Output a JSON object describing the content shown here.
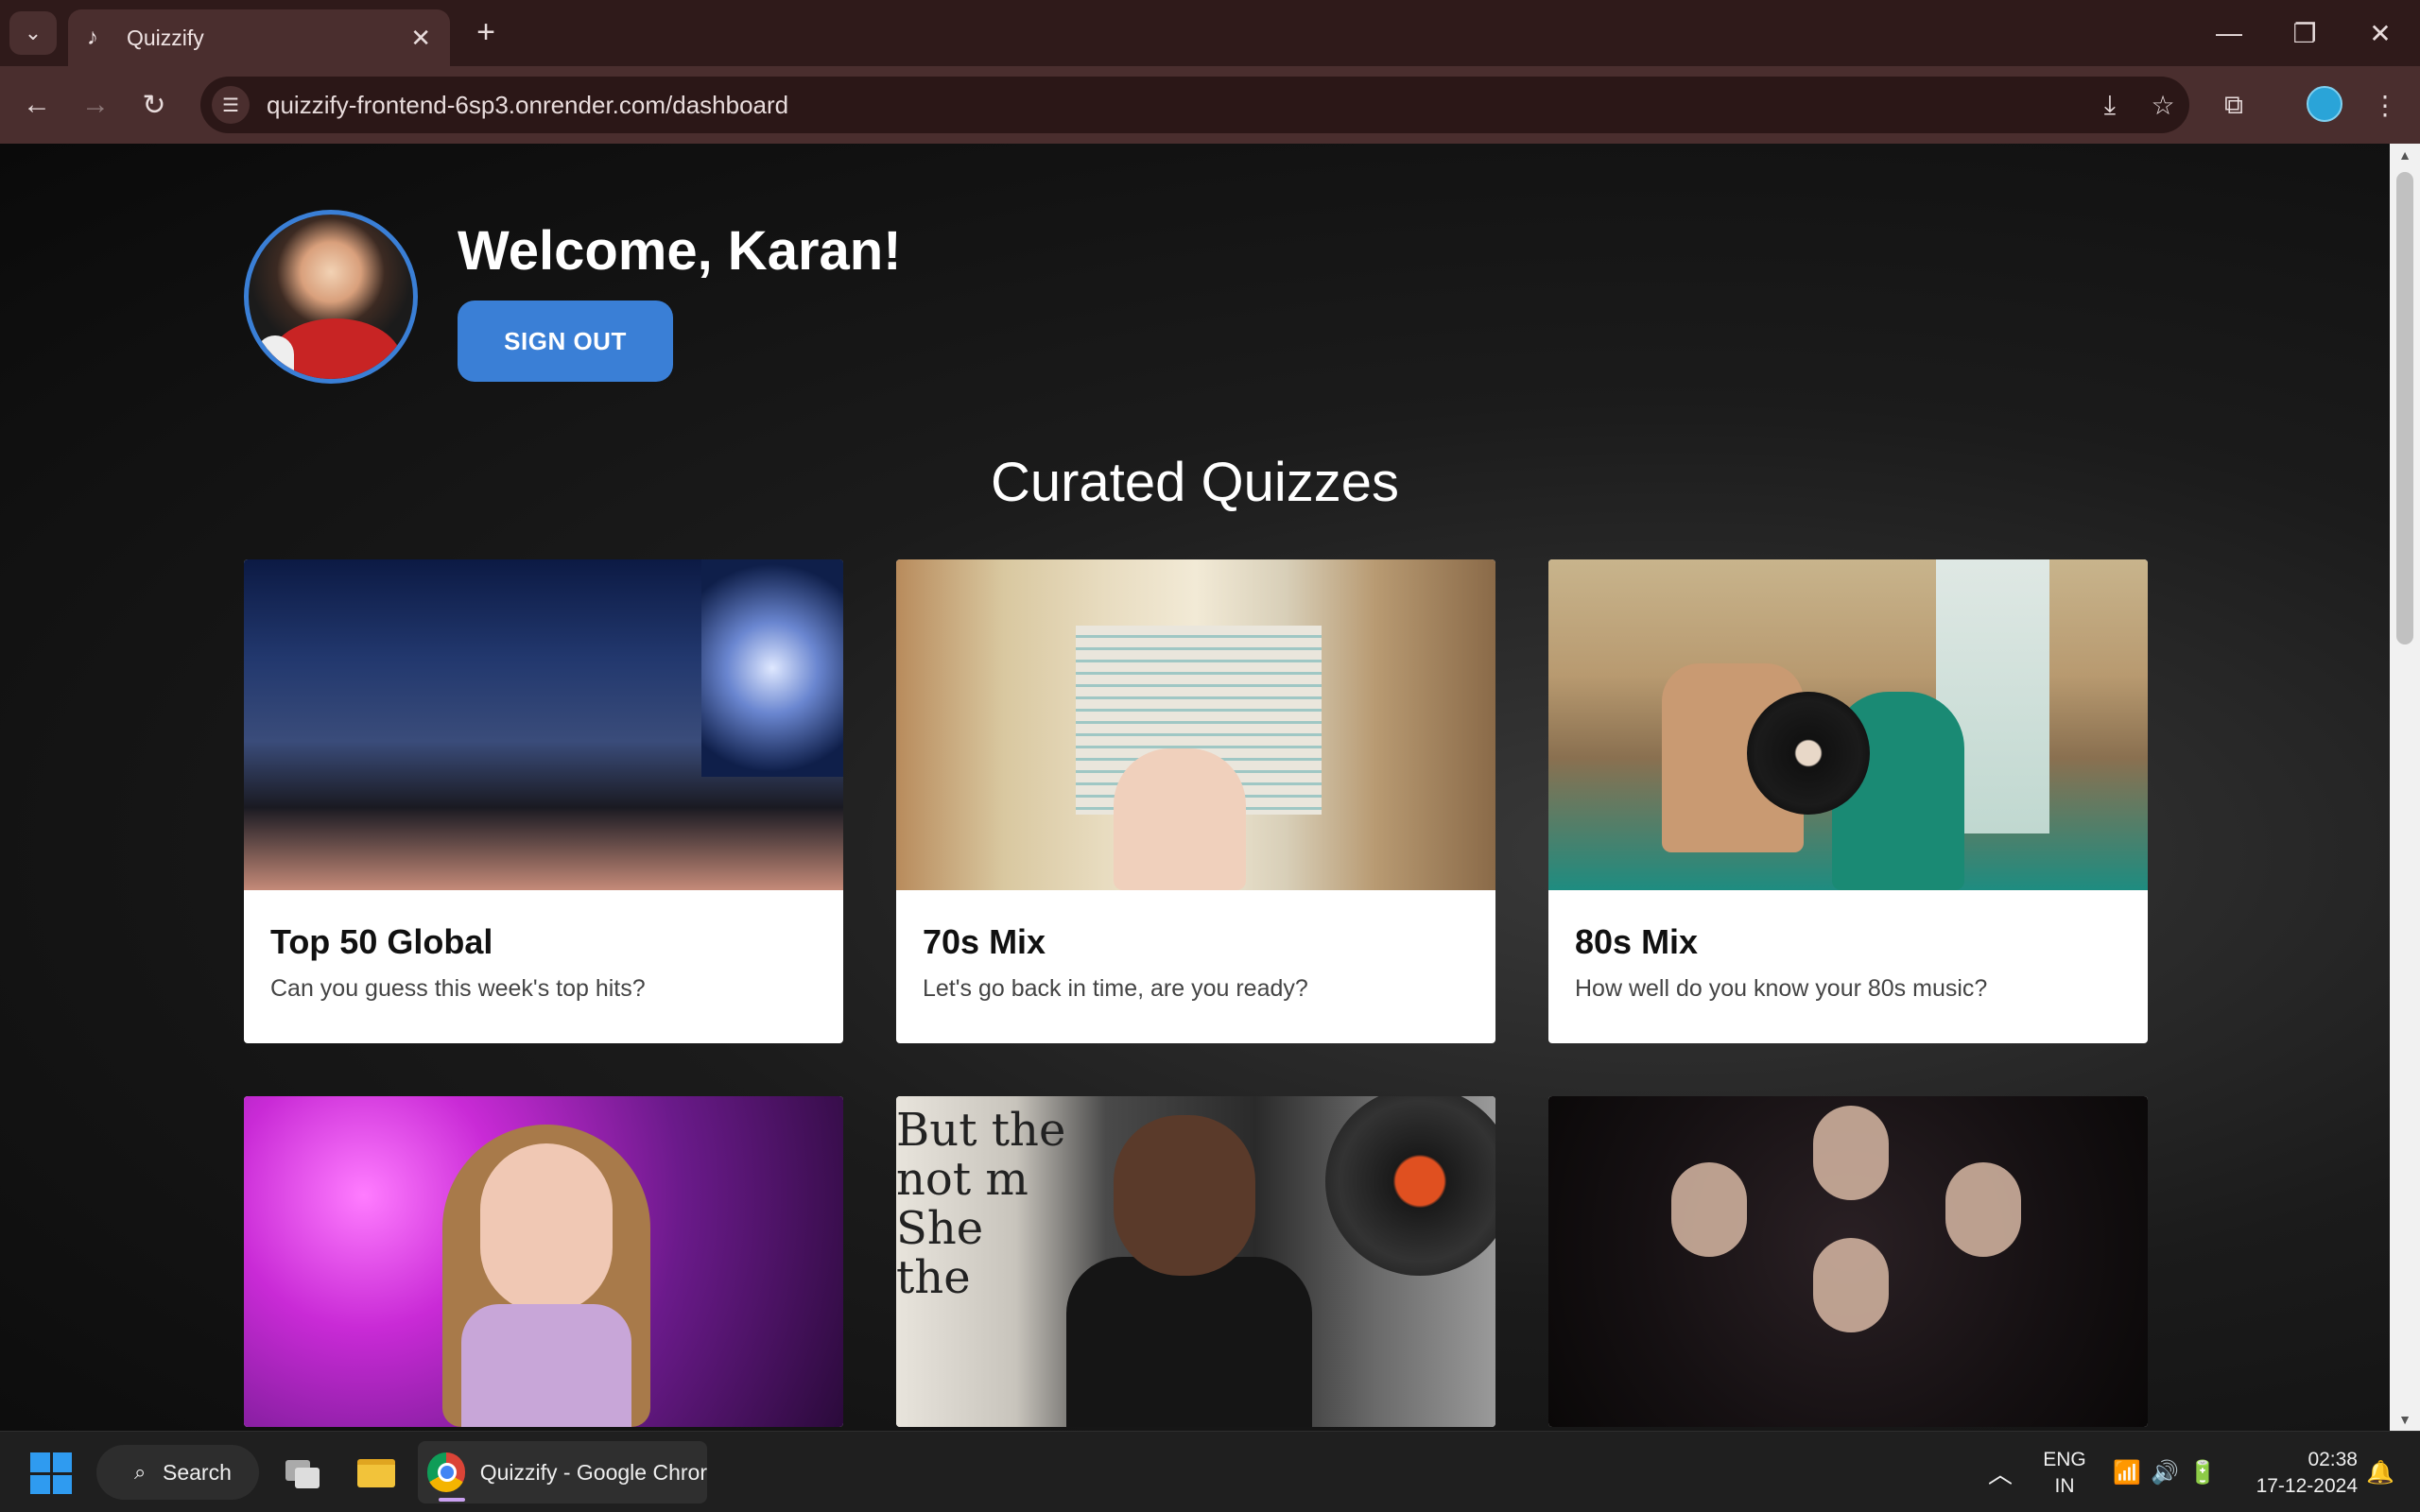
{
  "browser": {
    "tab_title": "Quizzify",
    "url": "quizzify-frontend-6sp3.onrender.com/dashboard",
    "icons": {
      "tab_list": "chevron-down-icon",
      "tab_favicon": "music-note-icon",
      "tab_close": "close-icon",
      "new_tab": "plus-icon",
      "back": "arrow-left-icon",
      "forward": "arrow-right-icon",
      "reload": "reload-icon",
      "site_info": "tune-icon",
      "install": "install-app-icon",
      "bookmark": "star-icon",
      "extensions": "puzzle-icon",
      "menu": "kebab-menu-icon"
    }
  },
  "page": {
    "welcome": "Welcome, Karan!",
    "sign_out": "SIGN OUT",
    "section_title": "Curated Quizzes",
    "accent_color": "#3a7fd6",
    "quizzes": [
      {
        "title": "Top 50 Global",
        "description": "Can you guess this week's top hits?"
      },
      {
        "title": "70s Mix",
        "description": "Let's go back in time, are you ready?"
      },
      {
        "title": "80s Mix",
        "description": "How well do you know your 80s music?"
      },
      {
        "title": "",
        "description": ""
      },
      {
        "title": "",
        "description": ""
      },
      {
        "title": "",
        "description": ""
      }
    ],
    "mj_poster_text": "But the\nnot m\nShe\nthe"
  },
  "taskbar": {
    "search_label": "Search",
    "chrome_label": "Quizzify - Google Chror",
    "lang_line1": "ENG",
    "lang_line2": "IN",
    "time": "02:38",
    "date": "17-12-2024"
  }
}
